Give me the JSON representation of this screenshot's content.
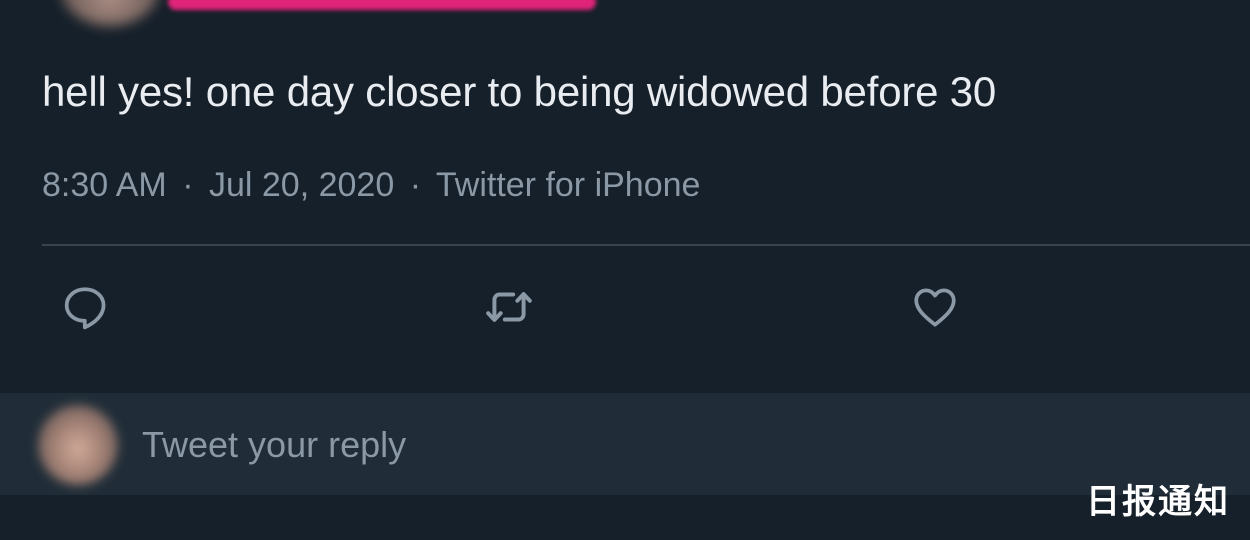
{
  "tweet": {
    "text": "hell yes! one day closer to being widowed before 30",
    "time": "8:30 AM",
    "date": "Jul 20, 2020",
    "source": "Twitter for iPhone",
    "separator": "·"
  },
  "actions": {
    "reply_icon": "reply-icon",
    "retweet_icon": "retweet-icon",
    "like_icon": "heart-icon"
  },
  "reply": {
    "placeholder": "Tweet your reply"
  },
  "watermark": {
    "text": "日报通知"
  },
  "colors": {
    "background": "#16202a",
    "text": "#e9edf1",
    "secondary_text": "#8b98a5",
    "divider": "#38444d",
    "reply_box": "#202d38",
    "highlight": "#e0247a"
  }
}
